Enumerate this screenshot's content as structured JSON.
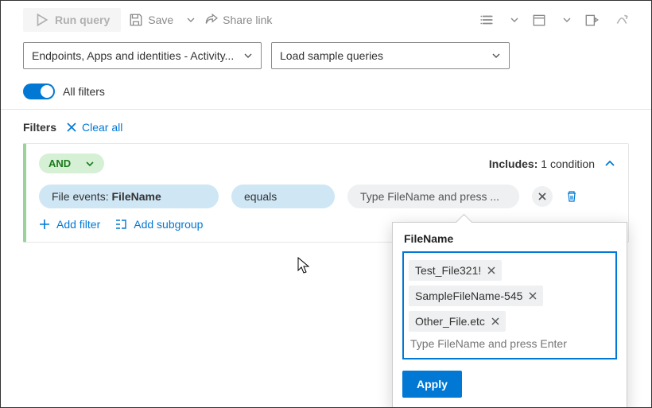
{
  "toolbar": {
    "run_label": "Run query",
    "save_label": "Save",
    "share_label": "Share link"
  },
  "dropdowns": {
    "scope_label": "Endpoints, Apps and identities - Activity...",
    "sample_label": "Load sample queries"
  },
  "allfilters_label": "All filters",
  "filters_header": {
    "title": "Filters",
    "clear_label": "Clear all"
  },
  "card": {
    "logic_label": "AND",
    "includes_label": "Includes:",
    "includes_value": "1 condition",
    "field_prefix": "File events: ",
    "field_name": "FileName",
    "operator": "equals",
    "value_placeholder": "Type FileName and press ...",
    "add_filter_label": "Add filter",
    "add_subgroup_label": "Add subgroup"
  },
  "popup": {
    "title": "FileName",
    "tags": [
      "Test_File321!",
      "SampleFileName-545",
      "Other_File.etc"
    ],
    "input_placeholder": "Type FileName and press Enter",
    "apply_label": "Apply"
  }
}
